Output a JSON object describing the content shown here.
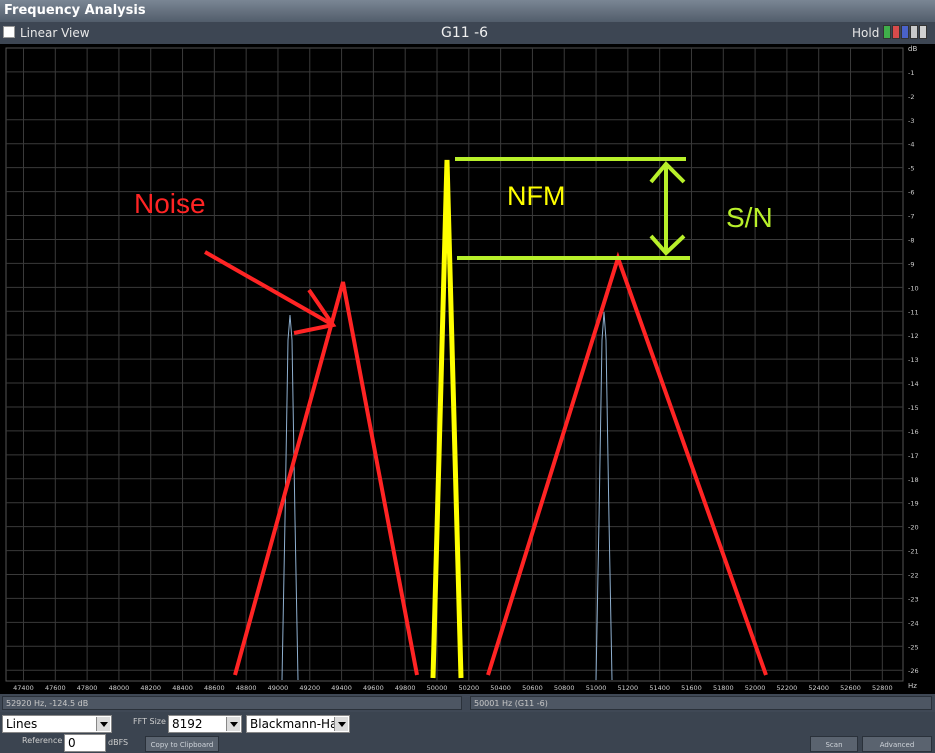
{
  "window": {
    "title": "Frequency Analysis"
  },
  "toolbar": {
    "linear_view_label": "Linear View",
    "channel": "G11 -6",
    "hold_label": "Hold"
  },
  "plot": {
    "db_unit": "dB",
    "hz_unit": "Hz",
    "db_ticks": [
      "-1",
      "-2",
      "-3",
      "-4",
      "-5",
      "-6",
      "-7",
      "-8",
      "-9",
      "-10",
      "-11",
      "-12",
      "-13",
      "-14",
      "-15",
      "-16",
      "-17",
      "-18",
      "-19",
      "-20",
      "-21",
      "-22",
      "-23",
      "-24",
      "-25",
      "-26"
    ],
    "freq_ticks": [
      "47400",
      "47600",
      "47800",
      "48000",
      "48200",
      "48400",
      "48600",
      "48800",
      "49000",
      "49200",
      "49400",
      "49600",
      "49800",
      "50000",
      "50200",
      "50400",
      "50600",
      "50800",
      "51000",
      "51200",
      "51400",
      "51600",
      "51800",
      "52000",
      "52200",
      "52400",
      "52600",
      "52800"
    ],
    "annotations": {
      "noise": "Noise",
      "nfm": "NFM",
      "sn": "S/N"
    },
    "colors": {
      "noise": "#ff2424",
      "nfm": "#ffff00",
      "sn": "#b8f02a",
      "grid": "#3a3a3a",
      "trace": "#8fb0d0"
    }
  },
  "status": {
    "cursor_readout": "52920 Hz, -124.5 dB",
    "peak_readout": "50001 Hz (G11 -6)"
  },
  "controls": {
    "display_mode": "Lines",
    "fft_size_label": "FFT Size",
    "fft_size": "8192",
    "window_fn": "Blackmann-Har",
    "reference_label": "Reference",
    "reference_value": "0",
    "reference_unit": "dBFS",
    "copy_label": "Copy to Clipboard",
    "scan_label": "Scan",
    "advanced_label": "Advanced"
  }
}
